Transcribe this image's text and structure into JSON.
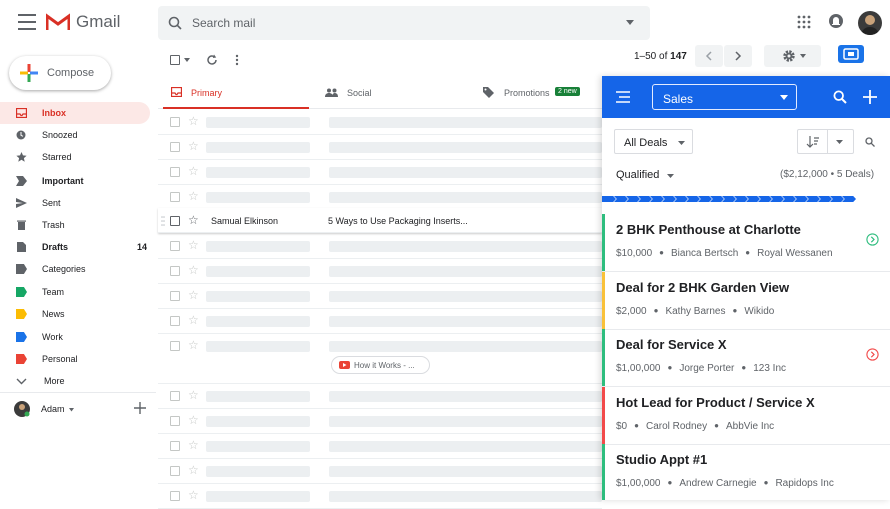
{
  "gmail": {
    "app_name": "Gmail",
    "search_placeholder": "Search mail",
    "compose_label": "Compose",
    "nav": [
      {
        "label": "Inbox",
        "count": "",
        "icon": "inbox-icon"
      },
      {
        "label": "Snoozed",
        "count": "",
        "icon": "clock-icon"
      },
      {
        "label": "Starred",
        "count": "",
        "icon": "star-icon"
      },
      {
        "label": "Important",
        "count": "",
        "icon": "important-icon"
      },
      {
        "label": "Sent",
        "count": "",
        "icon": "send-icon"
      },
      {
        "label": "Trash",
        "count": "",
        "icon": "trash-icon"
      },
      {
        "label": "Drafts",
        "count": "14",
        "icon": "draft-icon"
      },
      {
        "label": "Categories",
        "count": "",
        "icon": "label-icon"
      },
      {
        "label": "Team",
        "count": "",
        "icon": "label-icon"
      },
      {
        "label": "News",
        "count": "",
        "icon": "label-icon"
      },
      {
        "label": "Work",
        "count": "",
        "icon": "label-icon"
      },
      {
        "label": "Personal",
        "count": "",
        "icon": "label-icon"
      },
      {
        "label": "More",
        "count": "",
        "icon": "chevron-down-icon"
      }
    ],
    "user": {
      "name": "Adam"
    },
    "pager": {
      "prefix": "1–50 of ",
      "total": "147"
    },
    "tabs": [
      {
        "label": "Primary"
      },
      {
        "label": "Social"
      },
      {
        "label": "Promotions",
        "badge": "2 new"
      }
    ],
    "email": {
      "sender": "Samual Elkinson",
      "subject": "5 Ways to Use Packaging Inserts..."
    },
    "attachment_chip": "How it Works - ..."
  },
  "crm": {
    "pipeline": "Sales",
    "filter": "All Deals",
    "stage": "Qualified",
    "stage_summary": "($2,12,000 • 5 Deals)",
    "colors": {
      "header": "#1565e8",
      "green": "#2ebd7e",
      "yellow": "#f9c13a",
      "red": "#f24a4a"
    },
    "deals": [
      {
        "title": "2 BHK Penthouse at Charlotte",
        "value": "$10,000",
        "contact": "Bianca Bertsch",
        "company": "Royal Wessanen",
        "accent": "#2ebd7e",
        "status_icon": "green-circle-arrow-icon"
      },
      {
        "title": "Deal for 2 BHK Garden View",
        "value": "$2,000",
        "contact": "Kathy Barnes",
        "company": "Wikido",
        "accent": "#f9c13a",
        "status_icon": ""
      },
      {
        "title": "Deal for Service X",
        "value": "$1,00,000",
        "contact": "Jorge Porter",
        "company": "123 Inc",
        "accent": "#2ebd7e",
        "status_icon": "red-circle-arrow-icon"
      },
      {
        "title": "Hot Lead for Product / Service X",
        "value": "$0",
        "contact": "Carol Rodney",
        "company": "AbbVie Inc",
        "accent": "#f24a4a",
        "status_icon": ""
      },
      {
        "title": "Studio Appt #1",
        "value": "$1,00,000",
        "contact": "Andrew Carnegie",
        "company": "Rapidops Inc",
        "accent": "#2ebd7e",
        "status_icon": ""
      }
    ]
  }
}
